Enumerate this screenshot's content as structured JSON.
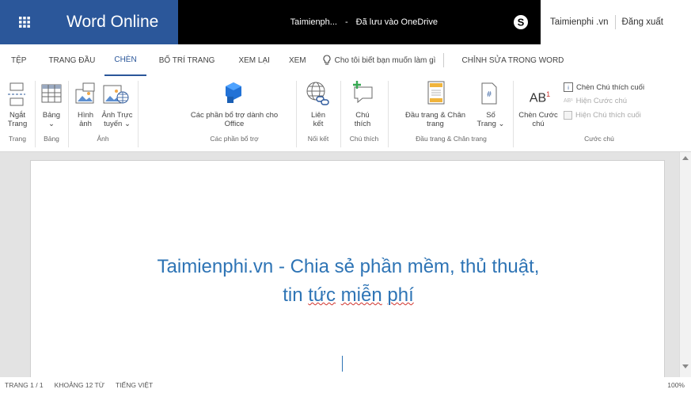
{
  "titlebar": {
    "app_name": "Word Online",
    "doc_name": "Taimienph...",
    "dash": "-",
    "save_status": "Đã lưu vào OneDrive",
    "account_name": "Taimienphi .vn",
    "signout": "Đăng xuất"
  },
  "tabs": [
    {
      "label": "TỆP"
    },
    {
      "label": "TRANG ĐẦU"
    },
    {
      "label": "CHÈN"
    },
    {
      "label": "BỐ TRÍ TRANG"
    },
    {
      "label": "XEM LẠI"
    },
    {
      "label": "XEM"
    }
  ],
  "tellme": "Cho tôi biết bạn muốn làm gì",
  "edit_in_word": "CHỈNH SỬA TRONG WORD",
  "ribbon": {
    "page_break_1": "Ngắt",
    "page_break_2": "Trang",
    "table_1": "Bảng",
    "table_2": "⌄",
    "picture_1": "Hình",
    "picture_2": "ảnh",
    "online_pic_1": "Ảnh Trực",
    "online_pic_2": "tuyến ⌄",
    "addins_1": "Các phần bổ trợ dành cho",
    "addins_2": "Office",
    "link_1": "Liên",
    "link_2": "kết",
    "comment_1": "Chú",
    "comment_2": "thích",
    "header_1": "Đầu trang & Chân",
    "header_2": "trang",
    "pagenum_1": "Số",
    "pagenum_2": "Trang ⌄",
    "footnote_1": "Chèn Cước",
    "footnote_2": "chú",
    "endnote": "Chèn Chú thích cuối",
    "show_footnote": "Hiện Cước chú",
    "show_endnote": "Hiện Chú thích cuối",
    "groups": {
      "pages": "Trang",
      "tables": "Bảng",
      "pictures": "Ảnh",
      "addins": "Các phần bổ trợ",
      "links": "Nối kết",
      "comments": "Chú thích",
      "headerfooter": "Đầu trang & Chân trang",
      "footnotes": "Cước chú"
    }
  },
  "document": {
    "line1": "Taimienphi.vn - Chia sẻ phần mềm, thủ thuật,",
    "line2_a": "tin ",
    "line2_b": "tức",
    "line2_c": " ",
    "line2_d": "miễn",
    "line2_e": " ",
    "line2_f": "phí"
  },
  "status": {
    "page": "TRANG 1 / 1",
    "words": "KHOẢNG 12 TỪ",
    "language": "TIẾNG VIỆT",
    "zoom": "100%"
  },
  "colors": {
    "brand": "#2b579a",
    "doc_text": "#2e74b5"
  }
}
